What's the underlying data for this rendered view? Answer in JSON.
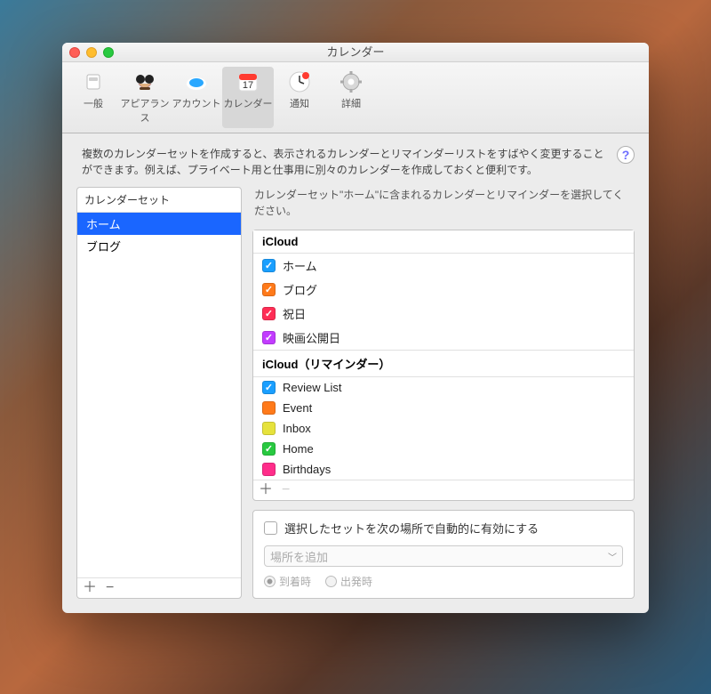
{
  "window": {
    "title": "カレンダー"
  },
  "toolbar": {
    "general": {
      "label": "一般"
    },
    "appearance": {
      "label": "アピアランス"
    },
    "accounts": {
      "label": "アカウント"
    },
    "calendars": {
      "label": "カレンダー"
    },
    "alerts": {
      "label": "通知"
    },
    "advanced": {
      "label": "詳細"
    }
  },
  "description": "複数のカレンダーセットを作成すると、表示されるカレンダーとリマインダーリストをすばやく変更することができます。例えば、プライベート用と仕事用に別々のカレンダーを作成しておくと便利です。",
  "help_glyph": "?",
  "sets": {
    "header": "カレンダーセット",
    "items": [
      {
        "label": "ホーム",
        "selected": true
      },
      {
        "label": "ブログ",
        "selected": false
      }
    ],
    "add": "＋",
    "remove": "−"
  },
  "right": {
    "description": "カレンダーセット\"ホーム\"に含まれるカレンダーとリマインダーを選択してください。",
    "groups": [
      {
        "name": "iCloud",
        "items": [
          {
            "label": "ホーム",
            "color": "#1a9fff",
            "checked": true
          },
          {
            "label": "ブログ",
            "color": "#ff7a1a",
            "checked": true
          },
          {
            "label": "祝日",
            "color": "#ff2d55",
            "checked": true
          },
          {
            "label": "映画公開日",
            "color": "#c23cff",
            "checked": true
          }
        ]
      },
      {
        "name": "iCloud（リマインダー）",
        "items": [
          {
            "label": "Review List",
            "color": "#1a9fff",
            "checked": true
          },
          {
            "label": "Event",
            "color": "#ff7a1a",
            "checked": false
          },
          {
            "label": "Inbox",
            "color": "#e6e23c",
            "checked": false
          },
          {
            "label": "Home",
            "color": "#28c940",
            "checked": true
          },
          {
            "label": "Birthdays",
            "color": "#ff2d8a",
            "checked": false
          }
        ]
      }
    ],
    "add": "＋",
    "remove": "−"
  },
  "auto": {
    "checkbox_label": "選択したセットを次の場所で自動的に有効にする",
    "placeholder": "場所を追加",
    "radio_arrive": "到着時",
    "radio_depart": "出発時"
  }
}
